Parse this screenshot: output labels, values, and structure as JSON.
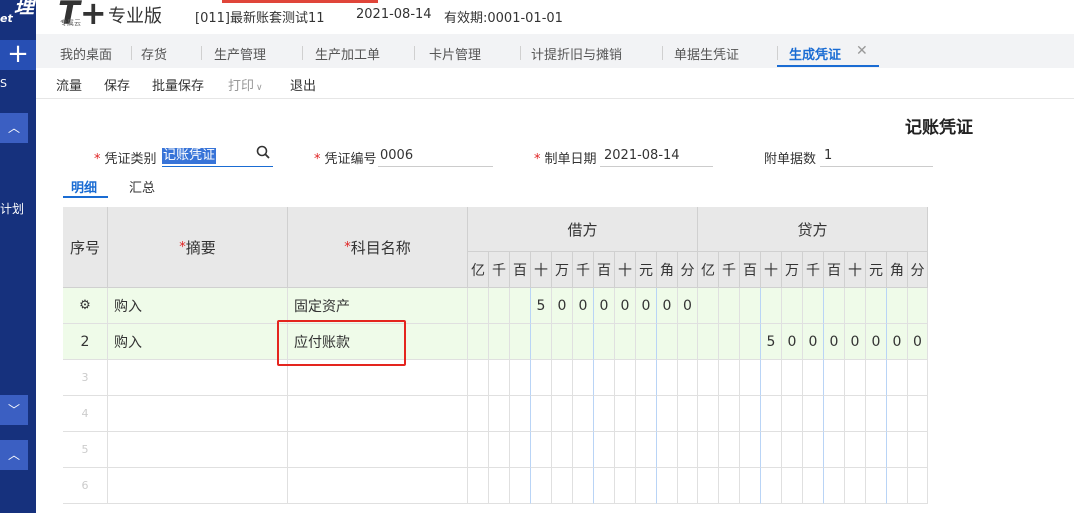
{
  "sidebar": {
    "logo_top": "理",
    "logo_bottom": "et",
    "side_text": "S",
    "plan_text": "计划"
  },
  "header": {
    "brand": "T+",
    "brand_sub": "专属云",
    "brand_text": "专业版",
    "account": "[011]最新账套测试11",
    "date": "2021-08-14",
    "validity": "有效期:0001-01-01"
  },
  "tabs": [
    {
      "label": "我的桌面"
    },
    {
      "label": "存货"
    },
    {
      "label": "生产管理"
    },
    {
      "label": "生产加工单"
    },
    {
      "label": "卡片管理"
    },
    {
      "label": "计提折旧与摊销"
    },
    {
      "label": "单据生凭证"
    },
    {
      "label": "生成凭证",
      "active": true
    }
  ],
  "toolbar": [
    "流量",
    "保存",
    "批量保存",
    "打印",
    "退出"
  ],
  "page_title": "记账凭证",
  "form": {
    "voucher_type_label": "凭证类别",
    "voucher_type_value": "记账凭证",
    "voucher_no_label": "凭证编号",
    "voucher_no_value": "0006",
    "date_label": "制单日期",
    "date_value": "2021-08-14",
    "attach_label": "附单据数",
    "attach_value": "1"
  },
  "subtabs": [
    "明细",
    "汇总"
  ],
  "table": {
    "headers": {
      "seq": "序号",
      "summary": "摘要",
      "account": "科目名称",
      "debit": "借方",
      "credit": "贷方"
    },
    "digit_units": [
      "亿",
      "千",
      "百",
      "十",
      "万",
      "千",
      "百",
      "十",
      "元",
      "角",
      "分"
    ],
    "rows": [
      {
        "seq": "",
        "summary": "购入",
        "account": "固定资产",
        "debit": [
          "",
          "",
          "",
          "5",
          "0",
          "0",
          "0",
          "0",
          "0",
          "0",
          "0"
        ],
        "credit": [
          "",
          "",
          "",
          "",
          "",
          "",
          "",
          "",
          "",
          "",
          ""
        ]
      },
      {
        "seq": "2",
        "summary": "购入",
        "account": "应付账款",
        "debit": [
          "",
          "",
          "",
          "",
          "",
          "",
          "",
          "",
          "",
          "",
          ""
        ],
        "credit": [
          "",
          "",
          "",
          "5",
          "0",
          "0",
          "0",
          "0",
          "0",
          "0",
          "0"
        ]
      },
      {
        "seq": "3"
      },
      {
        "seq": "4"
      },
      {
        "seq": "5"
      },
      {
        "seq": "6"
      }
    ]
  }
}
